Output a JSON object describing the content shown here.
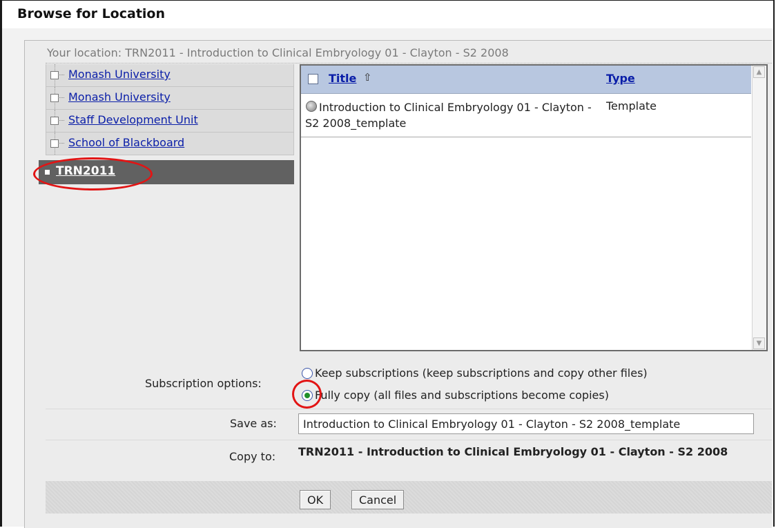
{
  "dialog": {
    "title": "Browse for Location"
  },
  "location": {
    "text": "Your location: TRN2011 - Introduction to Clinical Embryology 01 - Clayton - S2 2008"
  },
  "tree": {
    "items": [
      {
        "label": "Monash University"
      },
      {
        "label": "Monash University"
      },
      {
        "label": "Staff Development Unit"
      },
      {
        "label": "School of Blackboard"
      }
    ],
    "selected": {
      "label": "TRN2011"
    }
  },
  "list": {
    "columns": {
      "title": "Title",
      "type": "Type",
      "sort_icon": "sort-up-arrow"
    },
    "rows": [
      {
        "title": "Introduction to Clinical Embryology 01 - Clayton - S2 2008_template",
        "type": "Template"
      }
    ]
  },
  "subscription": {
    "label": "Subscription options:",
    "options": [
      {
        "label": "Keep subscriptions (keep subscriptions and copy other files)",
        "selected": false
      },
      {
        "label": "Fully copy (all files and subscriptions become copies)",
        "selected": true
      }
    ]
  },
  "save_as": {
    "label": "Save as:",
    "value": "Introduction to Clinical Embryology 01 - Clayton - S2 2008_template"
  },
  "copy_to": {
    "label": "Copy to:",
    "value": "TRN2011 - Introduction to Clinical Embryology 01 - Clayton - S2 2008"
  },
  "buttons": {
    "ok": "OK",
    "cancel": "Cancel"
  },
  "colors": {
    "highlight": "#e21414",
    "link": "#0a1ea8",
    "header": "#b8c7e0",
    "selected_tree": "#616161"
  }
}
